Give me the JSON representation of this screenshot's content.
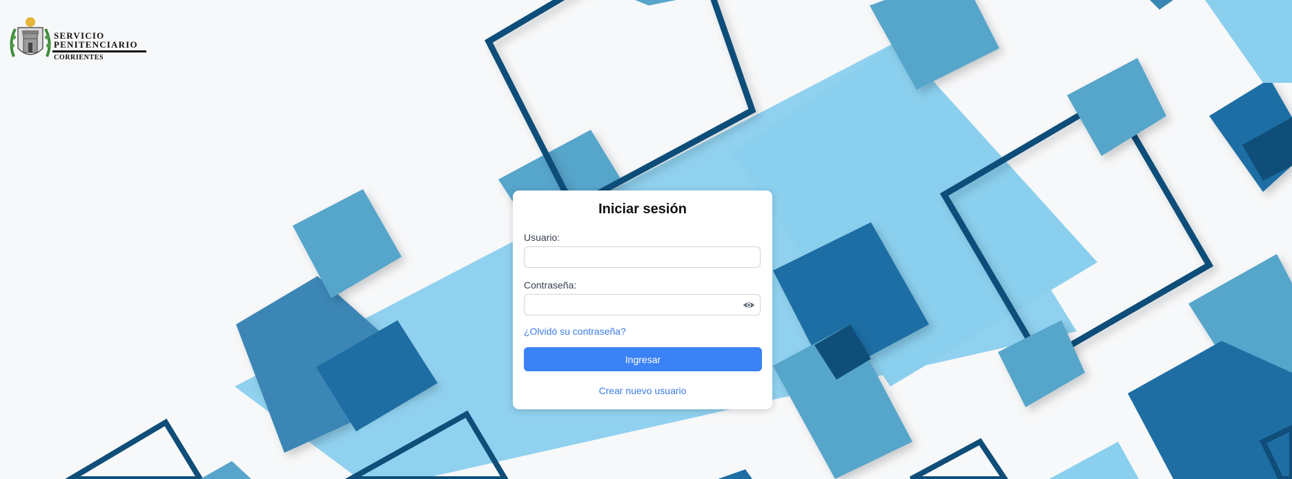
{
  "branding": {
    "line1": "SERVICIO",
    "line2": "PENITENCIARIO",
    "line3": "CORRIENTES"
  },
  "login": {
    "title": "Iniciar sesión",
    "username_label": "Usuario:",
    "username_value": "",
    "password_label": "Contraseña:",
    "password_value": "",
    "forgot_link": "¿Olvidó su contraseña?",
    "submit_label": "Ingresar",
    "create_user_link": "Crear nuevo usuario"
  },
  "icons": {
    "password_toggle": "eye-icon",
    "emblem": "coat-of-arms-emblem"
  },
  "colors": {
    "primary_button": "#3b82f6",
    "link": "#3b7be6",
    "light_blue": "#8acfee",
    "mid_blue": "#57a5cb",
    "deep_blue": "#1e6ea4",
    "navy": "#0f4e79"
  }
}
